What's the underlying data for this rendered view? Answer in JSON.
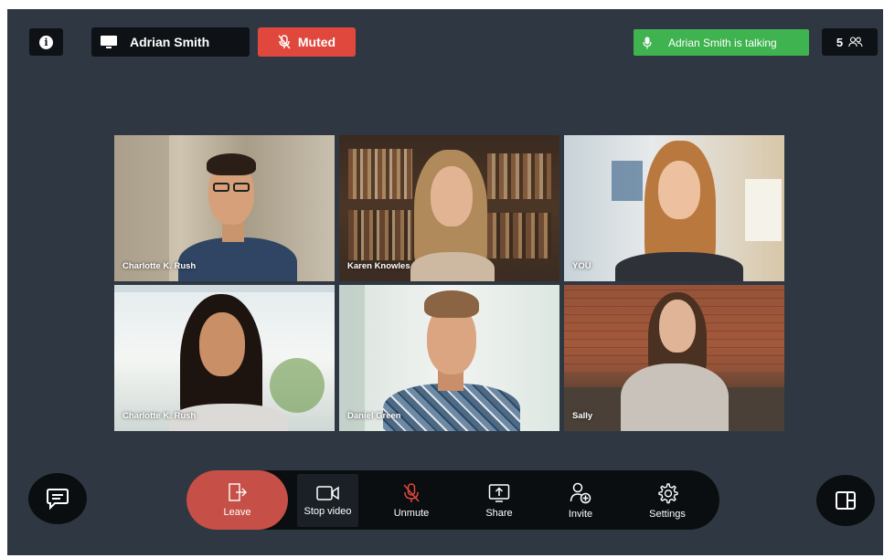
{
  "topbar": {
    "info_icon": "info-icon",
    "presenter_name": "Adrian Smith",
    "muted_label": "Muted",
    "talking_label": "Adrian Smith is talking",
    "participant_count": "5"
  },
  "participants": [
    {
      "name": "Charlotte K. Rush"
    },
    {
      "name": "Karen Knowles"
    },
    {
      "name": "YOU"
    },
    {
      "name": "Charlotte K. Rush"
    },
    {
      "name": "Daniel Green"
    },
    {
      "name": "Sally"
    }
  ],
  "controls": {
    "leave": "Leave",
    "stop_video": "Stop video",
    "unmute": "Unmute",
    "share": "Share",
    "invite": "Invite",
    "settings": "Settings"
  },
  "colors": {
    "background": "#2f3842",
    "muted": "#e0483e",
    "talking": "#3fb34f",
    "leave": "#c65047",
    "bar": "#0b0e11"
  }
}
